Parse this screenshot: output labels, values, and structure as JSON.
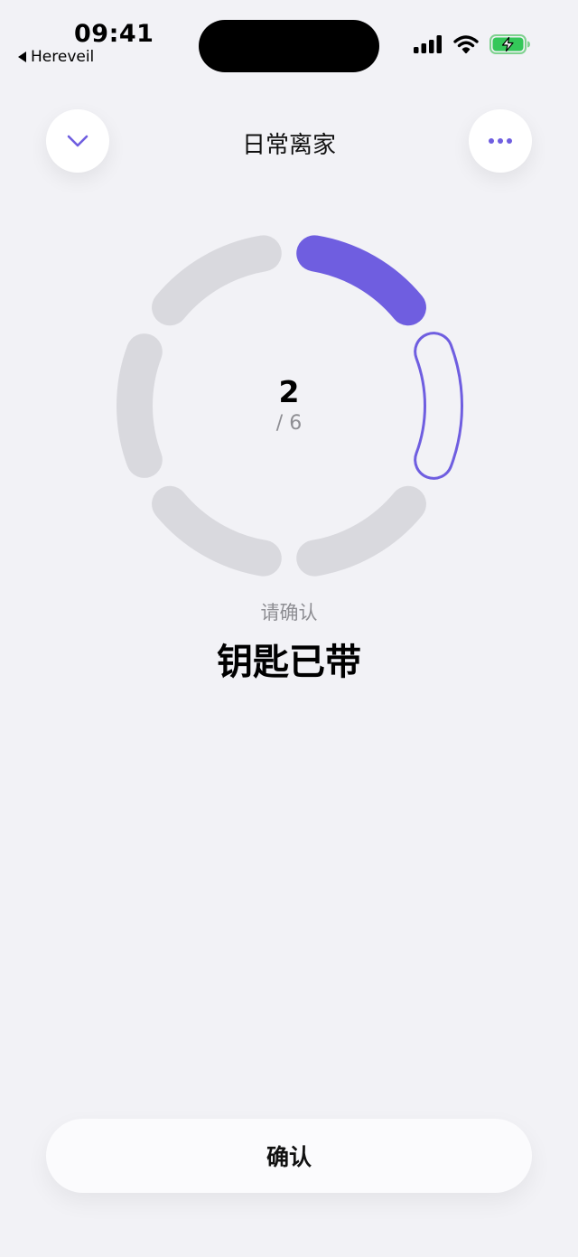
{
  "status_bar": {
    "time": "09:41",
    "back_app": "Hereveil"
  },
  "header": {
    "title": "日常离家"
  },
  "progress": {
    "current": "2",
    "total": "/ 6",
    "segments_total": 6,
    "segments_completed": 1,
    "current_segment": 2
  },
  "prompt": "请确认",
  "item_name": "钥匙已带",
  "confirm_label": "确认",
  "colors": {
    "accent": "#6f5ee0",
    "inactive": "#d9d9de",
    "background": "#f2f2f6",
    "battery": "#34c759"
  },
  "icons": {
    "left_button": "chevron-down-icon",
    "right_button": "more-icon",
    "signal": "cellular-signal-icon",
    "wifi": "wifi-icon",
    "battery": "battery-charging-icon"
  }
}
